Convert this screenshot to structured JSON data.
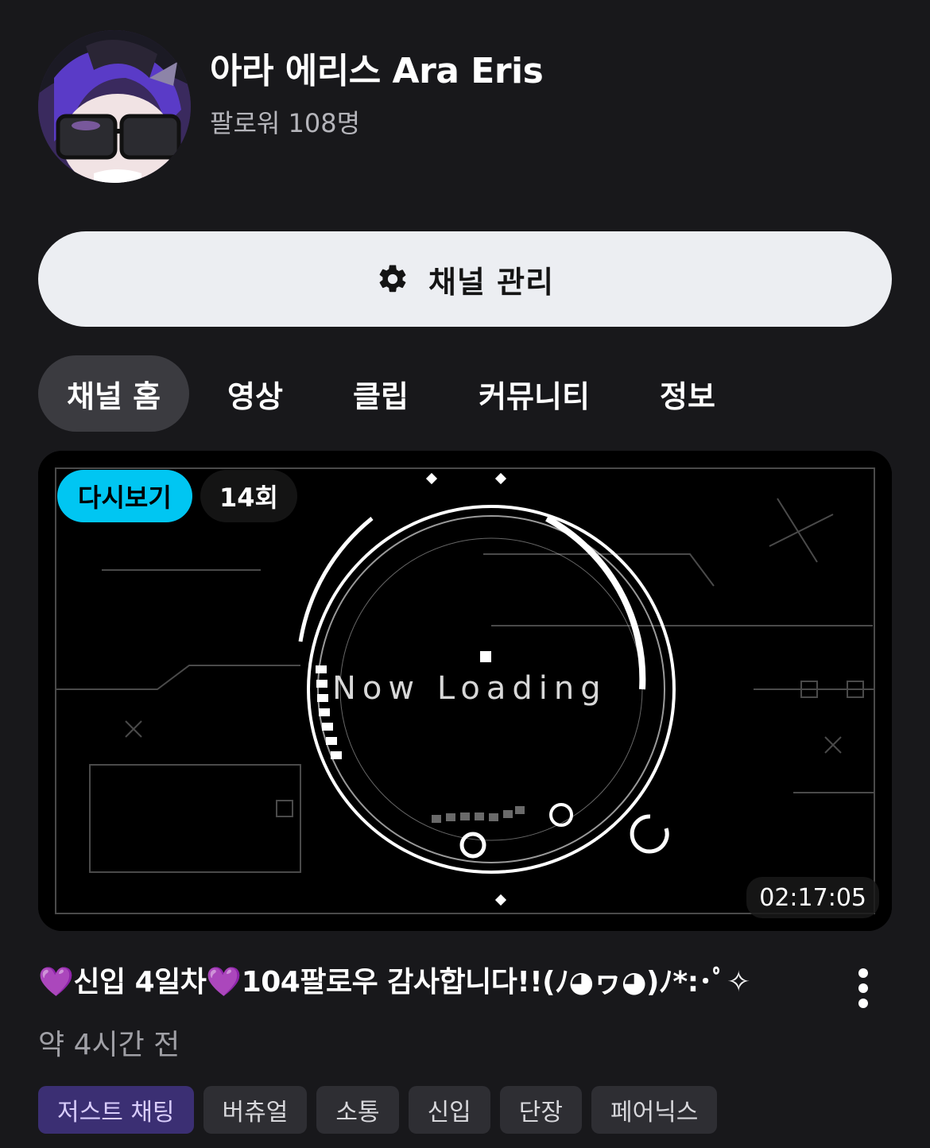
{
  "channel": {
    "name": "아라 에리스 Ara Eris",
    "followers": "팔로워 108명"
  },
  "manage_button": {
    "label": "채널 관리",
    "icon": "gear-icon"
  },
  "tabs": [
    {
      "label": "채널 홈",
      "active": true
    },
    {
      "label": "영상",
      "active": false
    },
    {
      "label": "클립",
      "active": false
    },
    {
      "label": "커뮤니티",
      "active": false
    },
    {
      "label": "정보",
      "active": false
    }
  ],
  "video": {
    "replay_badge": "다시보기",
    "count_badge": "14회",
    "thumbnail_text": "Now Loading",
    "duration": "02:17:05",
    "title": "💜신입 4일차💜104팔로우 감사합니다!!(ﾉ◕ヮ◕)ﾉ*:･ﾟ✧",
    "time_ago": "약 4시간 전",
    "tags": [
      {
        "label": "저스트 채팅",
        "category": true
      },
      {
        "label": "버츄얼",
        "category": false
      },
      {
        "label": "소통",
        "category": false
      },
      {
        "label": "신입",
        "category": false
      },
      {
        "label": "단장",
        "category": false
      },
      {
        "label": "페어닉스",
        "category": false
      }
    ]
  },
  "colors": {
    "background": "#18181b",
    "replay_badge": "#00c6f2",
    "category_tag": "#3b2f73",
    "button": "#eceef2"
  }
}
